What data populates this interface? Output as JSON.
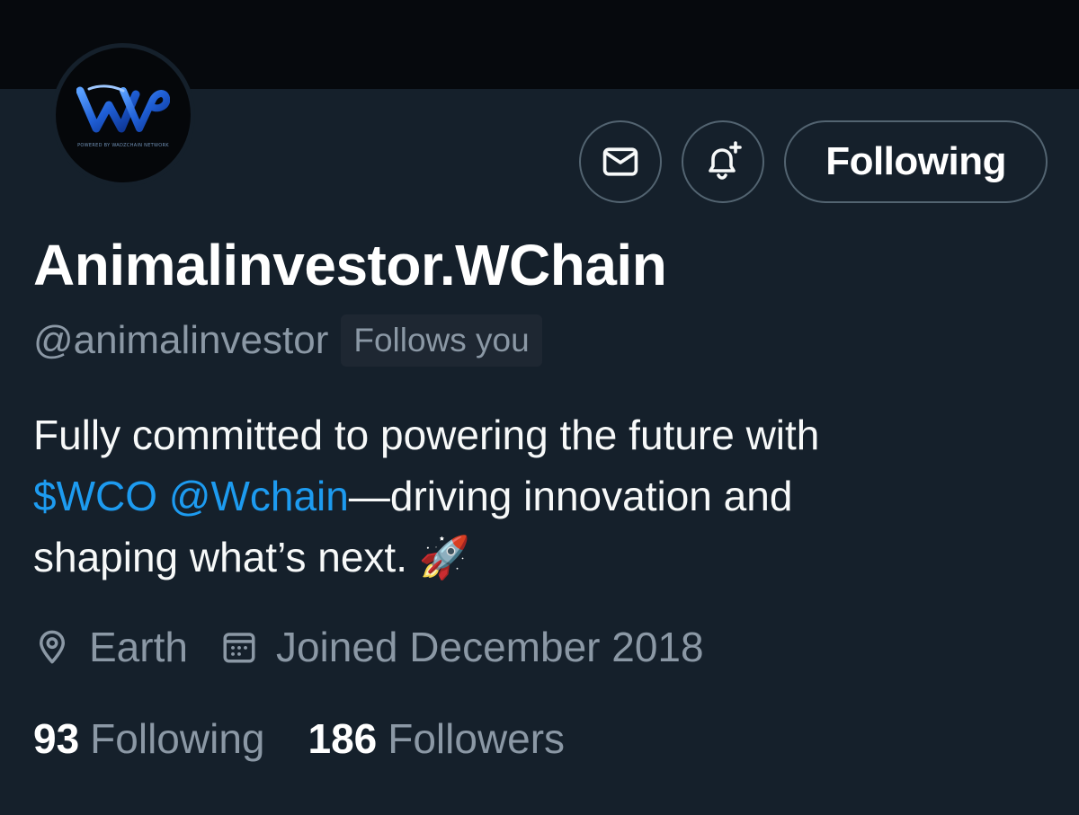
{
  "profile": {
    "display_name": "Animalinvestor.WChain",
    "handle": "@animalinvestor",
    "follows_you_badge": "Follows you",
    "avatar_tagline": "POWERED BY WADZCHAIN NETWORK",
    "avatar_icon": "wchain-logo-icon"
  },
  "actions": {
    "message_icon": "envelope-icon",
    "notify_icon": "bell-plus-icon",
    "following_label": "Following"
  },
  "bio": {
    "line1": "Fully committed to powering the future with",
    "cashtag": "$WCO",
    "mention": "@Wchain",
    "line2_rest": "—driving innovation and",
    "line3": "shaping what’s next.",
    "emoji": "🚀"
  },
  "meta": {
    "location": "Earth",
    "location_icon": "map-pin-icon",
    "joined": "Joined December 2018",
    "joined_icon": "calendar-icon"
  },
  "stats": {
    "following_count": "93",
    "following_label": "Following",
    "followers_count": "186",
    "followers_label": "Followers"
  },
  "colors": {
    "background": "#15202b",
    "banner": "#06090d",
    "link": "#1d9bf0",
    "secondary_text": "#8b98a5",
    "primary_text": "#f7f9f9"
  }
}
